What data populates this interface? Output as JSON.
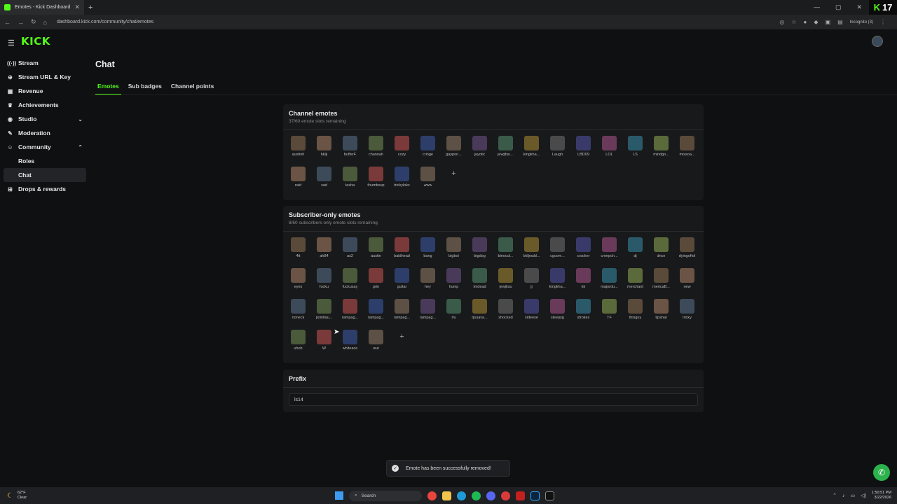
{
  "browser": {
    "tab_title": "Emotes - Kick Dashboard",
    "url": "dashboard.kick.com/community/chat/emotes",
    "incognito_label": "Incognito (3)",
    "corner_badge": "17"
  },
  "app": {
    "logo": "KICK",
    "page_title": "Chat",
    "sidebar": [
      {
        "label": "Stream",
        "icon": "stream-icon"
      },
      {
        "label": "Stream URL & Key",
        "icon": "link-icon"
      },
      {
        "label": "Revenue",
        "icon": "revenue-icon"
      },
      {
        "label": "Achievements",
        "icon": "trophy-icon"
      },
      {
        "label": "Studio",
        "icon": "studio-icon"
      },
      {
        "label": "Moderation",
        "icon": "wrench-icon"
      },
      {
        "label": "Community",
        "icon": "community-icon"
      },
      {
        "label": "Roles"
      },
      {
        "label": "Chat"
      },
      {
        "label": "Drops & rewards",
        "icon": "gift-icon"
      }
    ],
    "tabs": [
      "Emotes",
      "Sub badges",
      "Channel points"
    ],
    "channel_emotes": {
      "title": "Channel emotes",
      "subtitle": "37/60 emote slots remaining",
      "emotes": [
        "austinh",
        "bklji",
        "bufferF",
        "channah",
        "cozy",
        "cringe",
        "gaypon...",
        "jayotic",
        "jewjitsu...",
        "kingkha...",
        "Laugh",
        "LBD09",
        "LOL",
        "LS",
        "mindgo...",
        "missoa...",
        "raid",
        "sad",
        "tasha",
        "thumbsup",
        "trickylokz",
        "www"
      ]
    },
    "subscriber_emotes": {
      "title": "Subscriber-only emotes",
      "subtitle": "8/60 subscribers only emote slots remaining",
      "emotes": [
        "4tt",
        "ah84",
        "as2",
        "austin",
        "baldhead",
        "bang",
        "bigboi",
        "bigdog",
        "binocul...",
        "bkljradd...",
        "cgcom...",
        "cracker",
        "creepch...",
        "dj",
        "dnce",
        "dyingoftol",
        "eyes",
        "fucku",
        "fuckusay",
        "grin",
        "guitar",
        "hey",
        "hump",
        "imdead",
        "jewjitsu",
        "jj",
        "kingkha...",
        "kk",
        "majordu...",
        "merchant",
        "mericaB...",
        "new",
        "noneck",
        "pointlau...",
        "rampag...",
        "rampag...",
        "rampag...",
        "rampag...",
        "rlu",
        "rjsuava...",
        "shocked",
        "sideeye",
        "sleepyg",
        "strokes",
        "TF",
        "thisguy",
        "tipshat",
        "tricky",
        "uhoh",
        "W",
        "whiteace",
        "wut"
      ]
    },
    "prefix": {
      "title": "Prefix",
      "value": "ls14"
    },
    "toast": "Emote has been successfully removed!"
  },
  "colors": {
    "accent": "#53fc18",
    "background": "#0f1012",
    "card": "#18191b"
  },
  "taskbar": {
    "temp": "62°F",
    "condition": "Clear",
    "search_placeholder": "Search",
    "time": "1:50:51 PM",
    "date": "3/22/2026"
  }
}
